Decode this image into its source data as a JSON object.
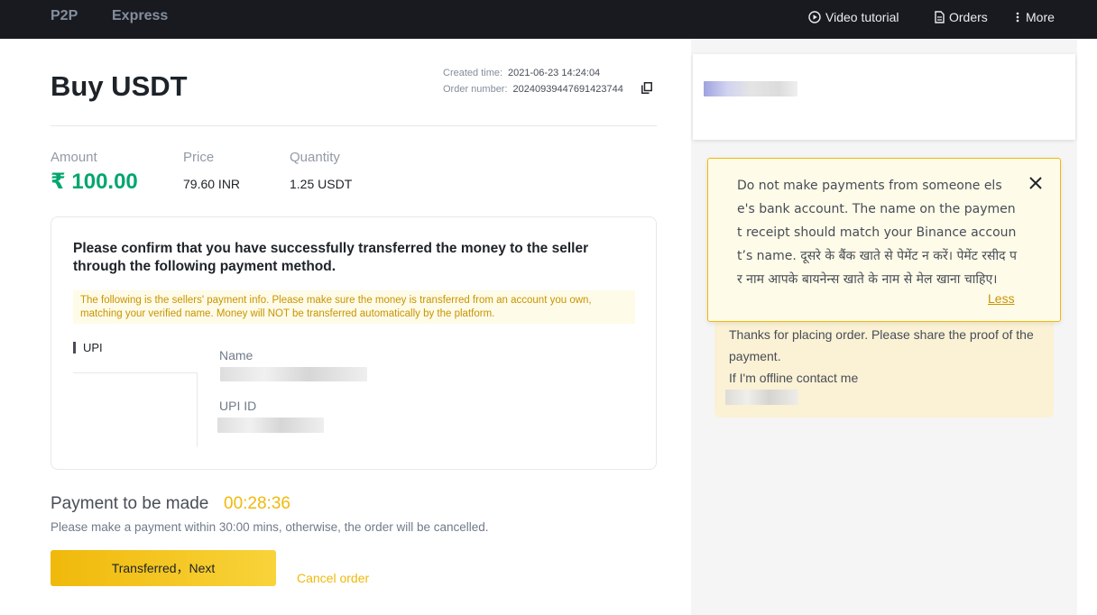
{
  "topbar": {
    "tab_p2p": "P2P",
    "tab_express": "Express",
    "video_tutorial": "Video tutorial",
    "orders": "Orders",
    "more": "More"
  },
  "order": {
    "title": "Buy USDT",
    "created_label": "Created time:",
    "created_value": "2021-06-23 14:24:04",
    "number_label": "Order number:",
    "number_value": "20240939447691423744"
  },
  "summary": {
    "amount_label": "Amount",
    "amount_value": "₹ 100.00",
    "price_label": "Price",
    "price_value": "79.60 INR",
    "quantity_label": "Quantity",
    "quantity_value": "1.25 USDT"
  },
  "payment_card": {
    "confirm_text": "Please confirm that you have successfully transferred the money to the seller through the following payment method.",
    "warning": "The following is the sellers' payment info. Please make sure the money is transferred from an account you own, matching your verified name. Money will NOT be transferred automatically by the platform.",
    "method": "UPI",
    "name_label": "Name",
    "upi_id_label": "UPI ID"
  },
  "payment": {
    "title": "Payment to be made",
    "timer": "00:28:36",
    "note": "Please make a payment within 30:00 mins, otherwise, the order will be cancelled.",
    "next_button": "Transferred，Next",
    "cancel": "Cancel order"
  },
  "chat": {
    "notice": "Do not make payments from someone else's bank account. The name on the payment receipt should match your Binance account’s name. दूसरे के बैंक खाते से पेमेंट न करें। पेमेंट रसीद पर नाम आपके बायनेन्स खाते के नाम से मेल खाना चाहिए।",
    "less": "Less",
    "message_line1": "Thanks for placing order. Please share the proof of the payment.",
    "message_line2": "If I'm offline contact me"
  },
  "colors": {
    "accent": "#f0b90b",
    "green": "#03a66d",
    "topbar": "#181a20"
  }
}
